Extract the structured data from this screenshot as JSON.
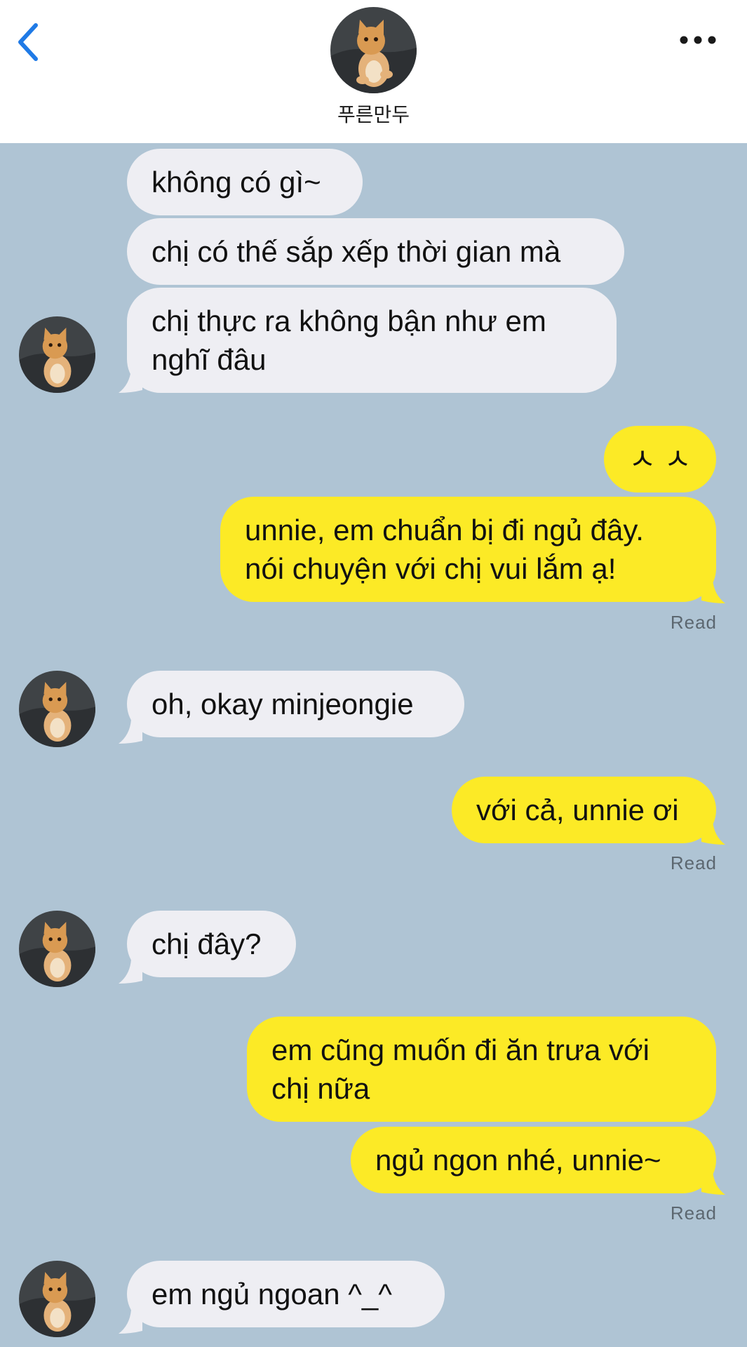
{
  "header": {
    "contact_name": "푸른만두",
    "back_icon": "chevron-left-icon",
    "more_icon": "ellipsis-icon",
    "accent_color": "#1f7ae6"
  },
  "messages": [
    {
      "from": "contact",
      "text": "không có gì~"
    },
    {
      "from": "contact",
      "text": "chị có thế sắp xếp thời gian mà"
    },
    {
      "from": "contact",
      "text": "chị thực ra không bận như em\nnghĩ đâu"
    },
    {
      "from": "me",
      "text": "ㅅ ㅅ"
    },
    {
      "from": "me",
      "text": "unnie, em chuẩn bị đi ngủ đây.\nnói chuyện với chị vui lắm ạ!",
      "status": "Read"
    },
    {
      "from": "contact",
      "text": "oh, okay minjeongie"
    },
    {
      "from": "me",
      "text": "với cả, unnie ơi",
      "status": "Read"
    },
    {
      "from": "contact",
      "text": "chị đây?"
    },
    {
      "from": "me",
      "text": "em cũng muốn đi ăn trưa với\nchị nữa"
    },
    {
      "from": "me",
      "text": "ngủ ngon nhé, unnie~",
      "status": "Read"
    },
    {
      "from": "contact",
      "text": "em ngủ ngoan ^_^"
    }
  ],
  "colors": {
    "chat_background": "#afc4d4",
    "incoming_bubble": "#eeeef3",
    "outgoing_bubble": "#fcea26"
  }
}
